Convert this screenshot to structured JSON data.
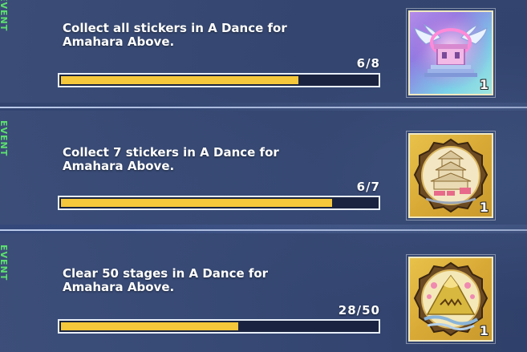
{
  "missions": [
    {
      "tag": "EVENT",
      "description": "Collect all stickers in A Dance for\nAmahara Above.",
      "progress_text": "6/8",
      "progress": 0.75,
      "reward": {
        "icon": "winged-shrine-sticker-icon",
        "quantity": "1"
      }
    },
    {
      "tag": "EVENT",
      "description": "Collect 7 stickers in A Dance for\nAmahara Above.",
      "progress_text": "6/7",
      "progress": 0.857,
      "reward": {
        "icon": "castle-medal-icon",
        "quantity": "1"
      }
    },
    {
      "tag": "EVENT",
      "description": "Clear 50 stages in A Dance for\nAmahara Above.",
      "progress_text": "28/50",
      "progress": 0.56,
      "reward": {
        "icon": "mountain-medal-icon",
        "quantity": "1"
      }
    }
  ],
  "colors": {
    "progress_fill": "#f5c73a",
    "event_tag": "#5ce06e"
  }
}
